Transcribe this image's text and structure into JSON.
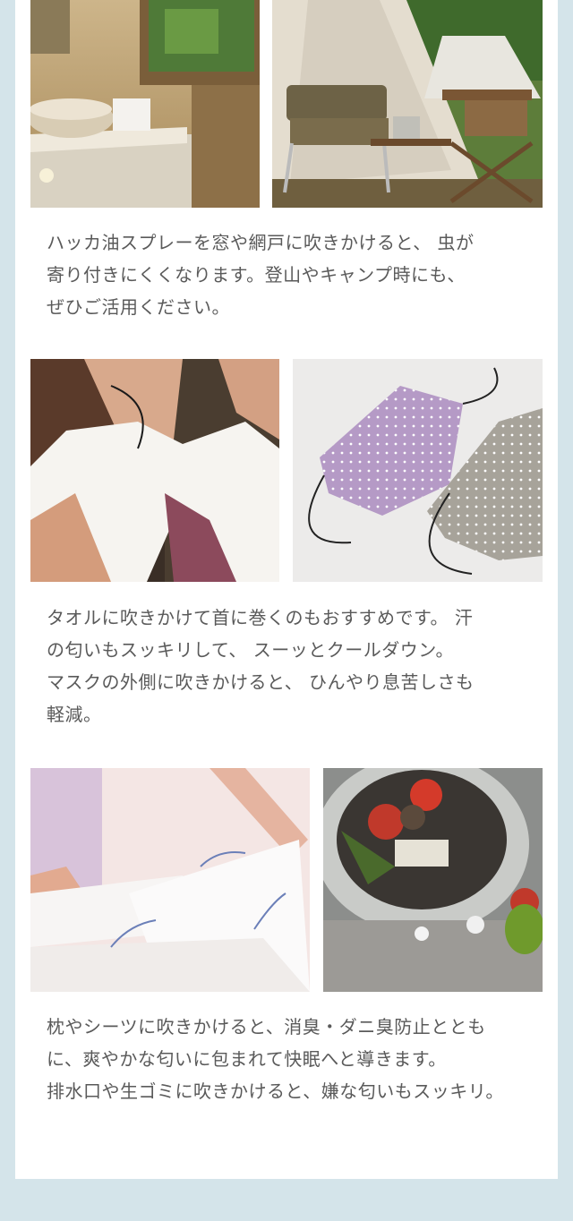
{
  "sections": [
    {
      "images": [
        {
          "name": "bathroom-photo"
        },
        {
          "name": "camping-tent-photo"
        }
      ],
      "caption_lines": [
        "ハッカ油スプレーを窓や網戸に吹きかけると、 虫が",
        "寄り付きにくくなります。登山やキャンプ時にも、",
        "ぜひご活用ください。"
      ]
    },
    {
      "images": [
        {
          "name": "woman-towel-photo"
        },
        {
          "name": "cloth-masks-photo"
        }
      ],
      "caption_lines": [
        "タオルに吹きかけて首に巻くのもおすすめです。 汗",
        "の匂いもスッキリして、 スーッとクールダウン。",
        "マスクの外側に吹きかけると、 ひんやり息苦しさも",
        "軽減。"
      ]
    },
    {
      "images": [
        {
          "name": "bed-sheets-photo"
        },
        {
          "name": "sink-drain-photo"
        }
      ],
      "caption_lines": [
        "枕やシーツに吹きかけると、消臭・ダニ臭防止ととも",
        "に、爽やかな匂いに包まれて快眠へと導きます。",
        "排水口や生ゴミに吹きかけると、嫌な匂いもスッキリ。"
      ]
    }
  ],
  "colors": {
    "background": "#d4e4ea",
    "card": "#ffffff",
    "text": "#5a5a5a"
  }
}
